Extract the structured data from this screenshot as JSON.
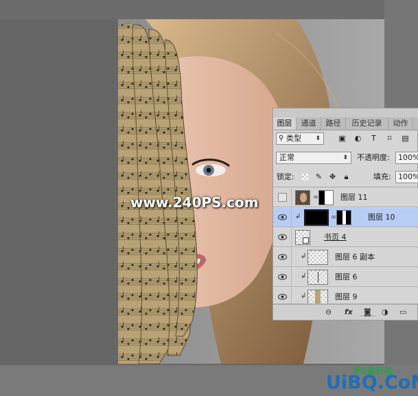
{
  "watermark": "www.240PS.com",
  "layers_panel": {
    "tabs": [
      {
        "label": "图层",
        "active": true
      },
      {
        "label": "通道",
        "active": false
      },
      {
        "label": "路径",
        "active": false
      },
      {
        "label": "历史记录",
        "active": false
      },
      {
        "label": "动作",
        "active": false
      }
    ],
    "kind_filter": "类型",
    "blend_mode": "正常",
    "opacity_label": "不透明度:",
    "opacity_value": "100%",
    "lock_label": "锁定:",
    "fill_label": "填充:",
    "fill_value": "100%",
    "layers": [
      {
        "name": "图层 11",
        "visible": false,
        "selected": false,
        "clipped": false
      },
      {
        "name": "图层 10",
        "visible": true,
        "selected": true,
        "clipped": true
      },
      {
        "name": "书页 4",
        "visible": true,
        "selected": false,
        "clipped": false
      },
      {
        "name": "图层 6 副本",
        "visible": true,
        "selected": false,
        "clipped": true
      },
      {
        "name": "图层 6",
        "visible": true,
        "selected": false,
        "clipped": true
      },
      {
        "name": "图层 9",
        "visible": true,
        "selected": false,
        "clipped": true
      }
    ],
    "footer_icons": [
      "link-icon",
      "fx-icon",
      "mask-icon",
      "adjustment-icon",
      "folder-icon"
    ],
    "footer_fx": "fx"
  },
  "logo": {
    "main": "UiBQ.CoM",
    "sub": "PS爱好者"
  }
}
